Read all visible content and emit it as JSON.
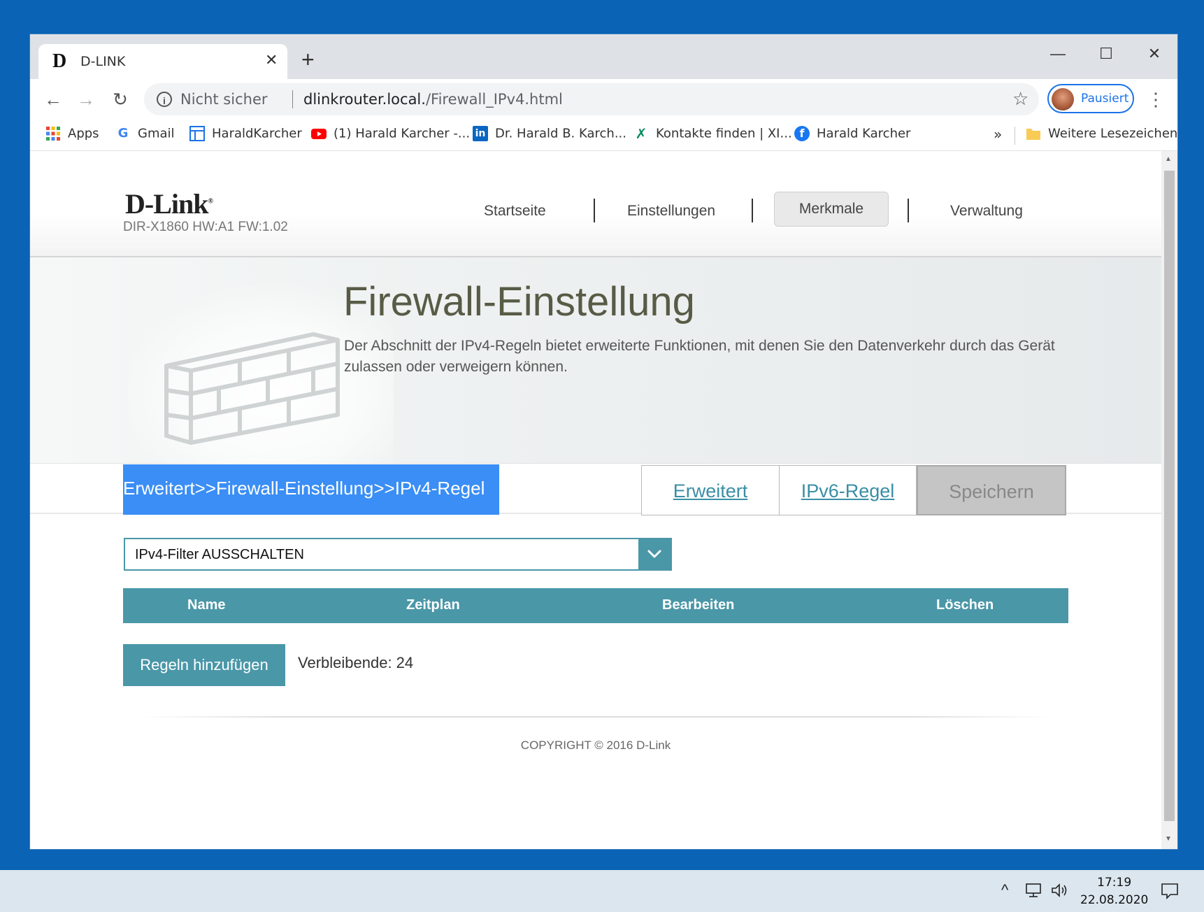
{
  "browser": {
    "tab": {
      "favicon": "D",
      "title": "D-LINK",
      "close": "✕"
    },
    "new_tab": "+",
    "window_controls": {
      "minimize": "—",
      "maximize": "☐",
      "close": "✕"
    },
    "nav": {
      "back": "←",
      "forward": "→",
      "reload": "↻"
    },
    "omnibox": {
      "info": "i",
      "security_label": "Nicht sicher",
      "url_host": "dlinkrouter.local.",
      "url_path": "/Firewall_IPv4.html",
      "star": "☆"
    },
    "profile": {
      "label": "Pausiert"
    },
    "menu": "⋮",
    "bookmarks": [
      {
        "icon": "apps-grid-icon",
        "label": "Apps"
      },
      {
        "icon": "google-icon",
        "label": "Gmail"
      },
      {
        "icon": "page-layout-icon",
        "label": "HaraldKarcher"
      },
      {
        "icon": "youtube-icon",
        "label": "(1) Harald Karcher -..."
      },
      {
        "icon": "linkedin-icon",
        "label": "Dr. Harald B. Karch..."
      },
      {
        "icon": "xing-icon",
        "label": "Kontakte finden | XI..."
      },
      {
        "icon": "facebook-icon",
        "label": "Harald Karcher"
      }
    ],
    "bookmarks_overflow": "»",
    "other_bookmarks": "Weitere Lesezeichen"
  },
  "router": {
    "logo": "D-Link",
    "logo_mark": "®",
    "model": "DIR-X1860 HW:A1 FW:1.02",
    "nav": [
      "Startseite",
      "Einstellungen",
      "Merkmale",
      "Verwaltung"
    ],
    "active_nav": "Merkmale",
    "title": "Firewall-Einstellung",
    "description": "Der Abschnitt der IPv4-Regeln bietet erweiterte Funktionen, mit denen Sie den Datenverkehr durch das Gerät zulassen oder verweigern können.",
    "breadcrumb": "Erweitert>>Firewall-Einstellung>>IPv4-Regel",
    "buttons": {
      "advanced": "Erweitert",
      "ipv6": "IPv6-Regel",
      "save": "Speichern"
    },
    "filter_select": {
      "value": "IPv4-Filter AUSSCHALTEN"
    },
    "table_headers": [
      "Name",
      "Zeitplan",
      "Bearbeiten",
      "Löschen"
    ],
    "add_button": "Regeln hinzufügen",
    "remaining": "Verbleibende: 24",
    "copyright": "COPYRIGHT © 2016 D-Link"
  },
  "taskbar": {
    "time": "17:19",
    "date": "22.08.2020",
    "tray_up": "^"
  },
  "colors": {
    "accent_teal": "#4a97a8",
    "breadcrumb_blue": "#3a8ef5",
    "desktop_blue": "#0a63b4"
  }
}
